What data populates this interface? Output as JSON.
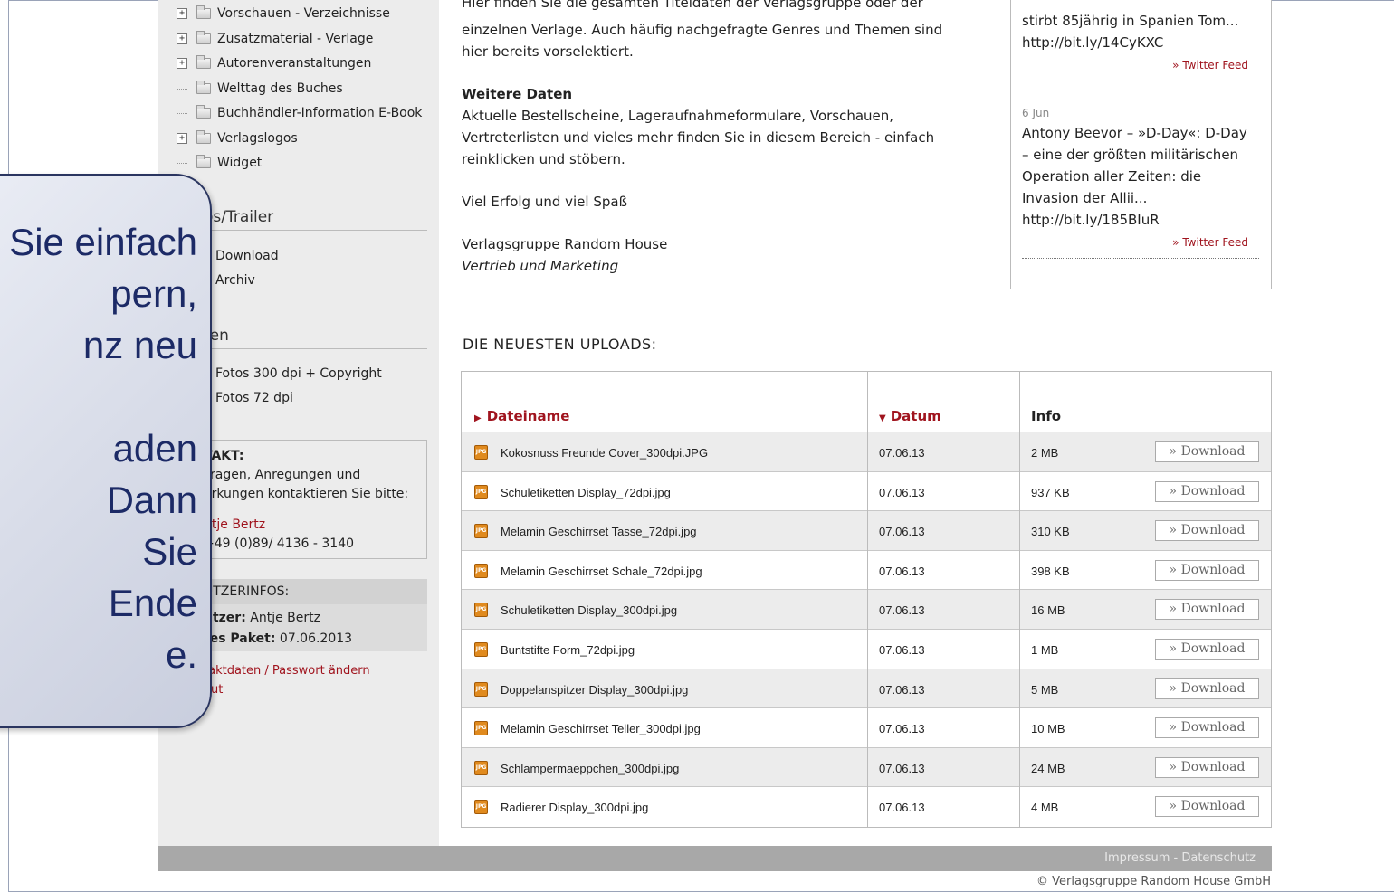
{
  "sidebar": {
    "tree": [
      {
        "label": "Vorschauen - Verzeichnisse",
        "expandable": true
      },
      {
        "label": "Zusatzmaterial - Verlage",
        "expandable": true
      },
      {
        "label": "Autorenveranstaltungen",
        "expandable": true
      },
      {
        "label": "Welttag des Buches",
        "expandable": false
      },
      {
        "label": "Buchhändler-Information E-Book",
        "expandable": false
      },
      {
        "label": "Verlagslogos",
        "expandable": true
      },
      {
        "label": "Widget",
        "expandable": false
      }
    ],
    "videos_heading": "os/Trailer",
    "videos_links": [
      "Download",
      "Archiv"
    ],
    "autoren_heading": "ren",
    "autoren_links": [
      "Fotos 300 dpi + Copyright",
      "Fotos 72 dpi"
    ],
    "kontakt": {
      "title": "TAKT:",
      "line1": "Fragen, Anregungen und",
      "line2": "erkungen kontaktieren Sie bitte:",
      "name": "ntje Bertz",
      "phone": "+49 (0)89/ 4136 - 3140"
    },
    "nutzer": {
      "title": "UTZERINFOS:",
      "user_label": "utzer:",
      "user_value": "Antje Bertz",
      "package_label": "tes Paket:",
      "package_value": "07.06.2013"
    },
    "links": {
      "contact_data": "taktdaten / Passwort ändern",
      "logout": "out"
    }
  },
  "callout": {
    "lines": [
      "Sie einfach",
      "pern,",
      "nz neu",
      "",
      "aden",
      "Dann",
      "Sie",
      "Ende",
      "e."
    ]
  },
  "main": {
    "intro_line1": "Hier finden Sie die gesamten Titeldaten der Verlagsgruppe oder der",
    "intro_line2": "einzelnen Verlage. Auch häufig nachgefragte Genres und Themen sind",
    "intro_line3": "hier bereits vorselektiert.",
    "weitere_title": "Weitere Daten",
    "weitere_line1": "Aktuelle Bestellscheine, Lageraufnahmeformulare, Vorschauen,",
    "weitere_line2": "Vertreterlisten und vieles mehr finden Sie in diesem Bereich - einfach",
    "weitere_line3": "reinklicken und stöbern.",
    "greeting": "Viel Erfolg und viel Spaß",
    "signature": "Verlagsgruppe Random House",
    "department": "Vertrieb und Marketing"
  },
  "twitter": {
    "tweet1_line1": "stirbt 85jährig in Spanien  Tom...",
    "tweet1_line2": "http://bit.ly/14CyKXC",
    "feed_label": "» Twitter Feed",
    "tweet2_date": "6 Jun",
    "tweet2_lines": [
      "Antony Beevor – »D-Day«: D-Day",
      "– eine der größten militärischen",
      "Operation aller Zeiten: die",
      "Invasion der Allii...",
      "http://bit.ly/185BIuR"
    ]
  },
  "uploads": {
    "title": "DIE NEUESTEN UPLOADS:",
    "columns": {
      "filename": "Dateiname",
      "date": "Datum",
      "info": "Info"
    },
    "download_label": "» Download",
    "icon_text": "JPG",
    "rows": [
      {
        "file": "Kokosnuss Freunde Cover_300dpi.JPG",
        "date": "07.06.13",
        "size": "2 MB"
      },
      {
        "file": "Schuletiketten Display_72dpi.jpg",
        "date": "07.06.13",
        "size": "937 KB"
      },
      {
        "file": "Melamin Geschirrset Tasse_72dpi.jpg",
        "date": "07.06.13",
        "size": "310 KB"
      },
      {
        "file": "Melamin Geschirrset Schale_72dpi.jpg",
        "date": "07.06.13",
        "size": "398 KB"
      },
      {
        "file": "Schuletiketten Display_300dpi.jpg",
        "date": "07.06.13",
        "size": "16 MB"
      },
      {
        "file": "Buntstifte Form_72dpi.jpg",
        "date": "07.06.13",
        "size": "1 MB"
      },
      {
        "file": "Doppelanspitzer Display_300dpi.jpg",
        "date": "07.06.13",
        "size": "5 MB"
      },
      {
        "file": "Melamin Geschirrset Teller_300dpi.jpg",
        "date": "07.06.13",
        "size": "10 MB"
      },
      {
        "file": "Schlampermaeppchen_300dpi.jpg",
        "date": "07.06.13",
        "size": "24 MB"
      },
      {
        "file": "Radierer Display_300dpi.jpg",
        "date": "07.06.13",
        "size": "4 MB"
      }
    ]
  },
  "footer": {
    "impressum": "Impressum",
    "separator": " - ",
    "datenschutz": "Datenschutz",
    "copyright": "© Verlagsgruppe Random House GmbH"
  },
  "colors": {
    "accent_red": "#a0141e",
    "callout_text": "#1c2a66",
    "callout_border": "#2a3560"
  }
}
